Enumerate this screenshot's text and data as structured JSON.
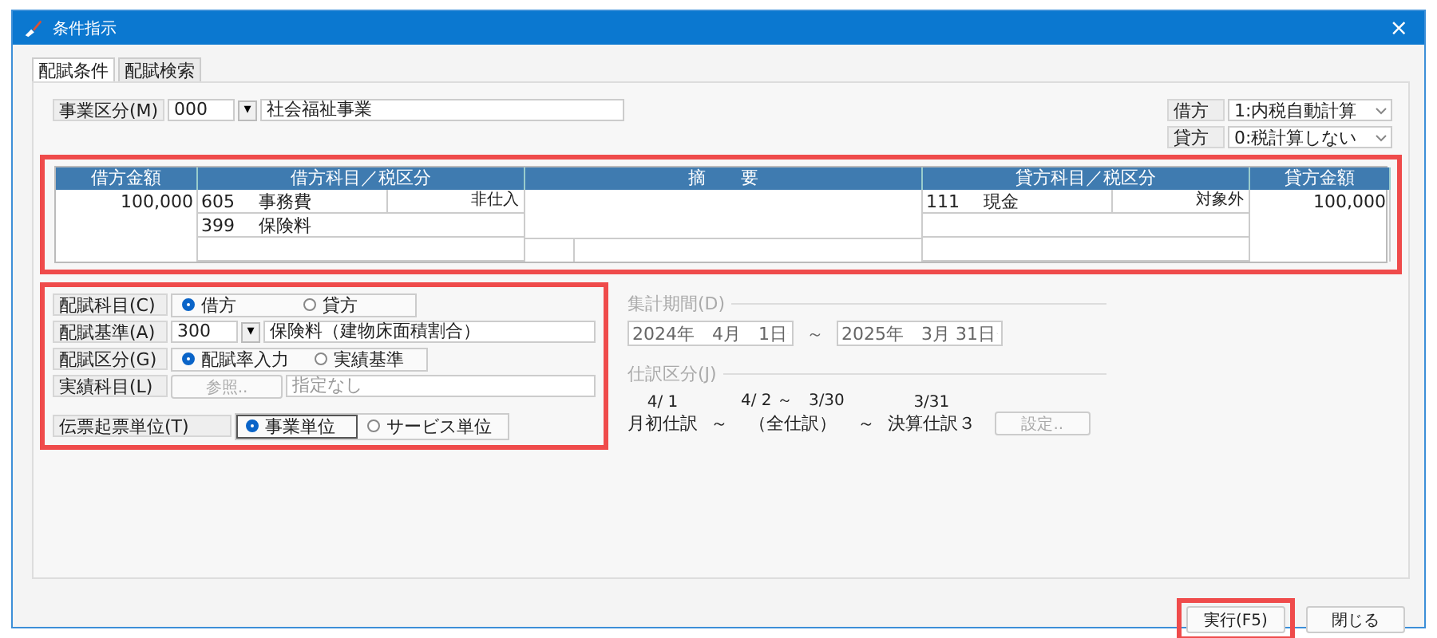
{
  "window": {
    "title": "条件指示",
    "close": "×"
  },
  "tabs": [
    {
      "label": "配賦条件",
      "selected": true
    },
    {
      "label": "配賦検索",
      "selected": false
    }
  ],
  "business_division": {
    "label": "事業区分(M)",
    "code": "000",
    "dropdown": "▾",
    "name": "社会福祉事業"
  },
  "tax_settings": [
    {
      "label": "借方",
      "value": "1:内税自動計算"
    },
    {
      "label": "貸方",
      "value": "0:税計算しない"
    }
  ],
  "journal_table": {
    "highlighted": true,
    "columns": [
      "借方金額",
      "借方科目／税区分",
      "摘　　要",
      "貸方科目／税区分",
      "貸方金額"
    ],
    "debit_amount": "100,000",
    "debit_rows": [
      {
        "code": "605",
        "name": "事務費",
        "tax": "非仕入"
      },
      {
        "code": "399",
        "name": "保険料"
      }
    ],
    "credit_rows": [
      {
        "code": "111",
        "name": "現金",
        "tax": "対象外"
      }
    ],
    "credit_amount": "100,000"
  },
  "allocation": {
    "highlighted": true,
    "rows": [
      {
        "kind": "radio",
        "label": "配賦科目(C)",
        "options": [
          {
            "label": "借方",
            "selected": true
          },
          {
            "label": "貸方",
            "selected": false
          }
        ]
      },
      {
        "kind": "combo",
        "label": "配賦基準(A)",
        "code": "300",
        "dropdown": "▾",
        "name": "保険料（建物床面積割合）"
      },
      {
        "kind": "radio",
        "label": "配賦区分(G)",
        "options": [
          {
            "label": "配賦率入力",
            "selected": true
          },
          {
            "label": "実績基準",
            "selected": false
          }
        ]
      },
      {
        "kind": "reference",
        "label": "実績科目(L)",
        "button": "参照..",
        "value": "指定なし",
        "disabled": true
      }
    ],
    "slip_unit": {
      "label": "伝票起票単位(T)",
      "options": [
        {
          "label": "事業単位",
          "selected": true
        },
        {
          "label": "サービス単位",
          "selected": false
        }
      ]
    }
  },
  "period": {
    "label": "集計期間(D)",
    "from": "2024年　4月　1日",
    "to": "2025年　3月 31日",
    "separator": "～",
    "disabled": true
  },
  "journal_class": {
    "label": "仕訳区分(J)",
    "items": [
      {
        "kind": "entry",
        "date": "4/ 1",
        "label": "月初仕訳"
      },
      {
        "kind": "sep",
        "label": "～"
      },
      {
        "kind": "entry",
        "date": "4/ 2 ～　3/30",
        "label": "（全仕訳）"
      },
      {
        "kind": "sep",
        "label": "～"
      },
      {
        "kind": "entry",
        "date": "3/31",
        "label": "決算仕訳３"
      }
    ],
    "button": "設定..",
    "disabled": true
  },
  "buttons": [
    {
      "label": "実行(F5)",
      "highlighted": true
    },
    {
      "label": "閉じる",
      "highlighted": false
    }
  ]
}
